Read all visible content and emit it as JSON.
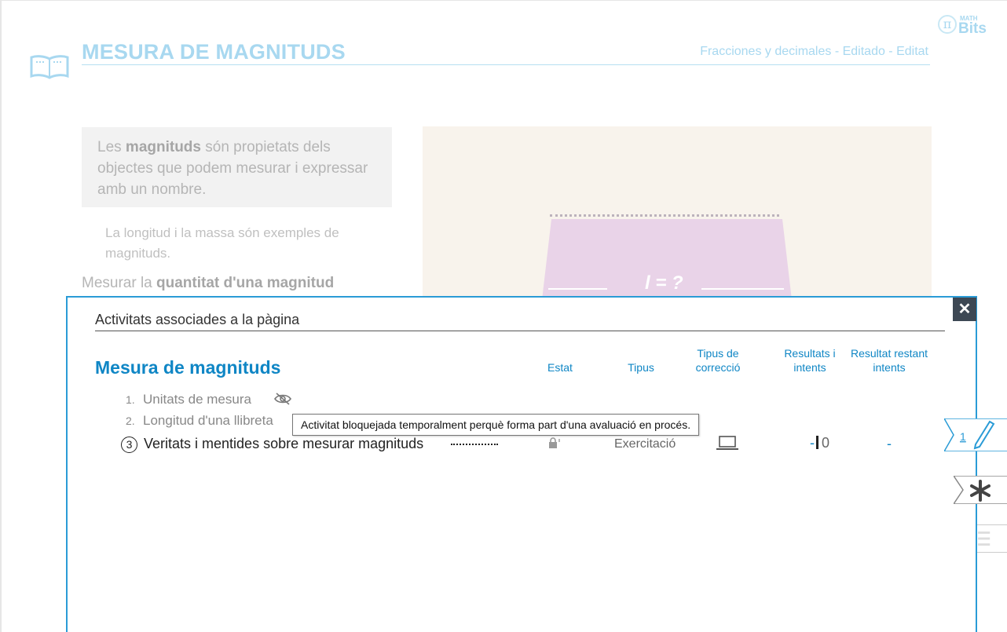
{
  "header": {
    "title": "MESURA DE MAGNITUDS",
    "breadcrumb": "Fracciones y decimales - Editado - Editat",
    "logo_top": "MATH",
    "logo_bottom": "Bits",
    "logo_symbol": "π"
  },
  "content": {
    "def_pre": "Les ",
    "def_bold": "magnituds",
    "def_post": " són propietats dels objectes que podem mesurar i expressar amb un nombre.",
    "example": "La longitud i la massa són exemples de magnituds.",
    "measure_pre": "Mesurar la ",
    "measure_bold": "quantitat d'una magnitud",
    "image_label": "l = ?"
  },
  "modal": {
    "title": "Activitats associades a la pàgina",
    "close": "✕",
    "section_title": "Mesura de magnituds",
    "columns": {
      "estat": "Estat",
      "tipus": "Tipus",
      "correccio": "Tipus de correcció",
      "resultats": "Resultats i intents",
      "restant": "Resultat restant intents"
    },
    "activities": [
      {
        "num": "1.",
        "label": "Unitats de mesura"
      },
      {
        "num": "2.",
        "label": "Longitud d'una llibreta"
      },
      {
        "num": "3",
        "label": "Veritats i mentides sobre mesurar magnituds",
        "type": "Exercitació",
        "result_dash": "-",
        "result_attempts": "0",
        "remaining": "-"
      }
    ],
    "tooltip": "Activitat bloquejada temporalment perquè forma part d'una avaluació en procés."
  },
  "side_tabs": {
    "edit_count": "1"
  },
  "colors": {
    "accent": "#0f86c5",
    "modal_border": "#2a9bd6",
    "faded_title": "#a8d8f0"
  }
}
